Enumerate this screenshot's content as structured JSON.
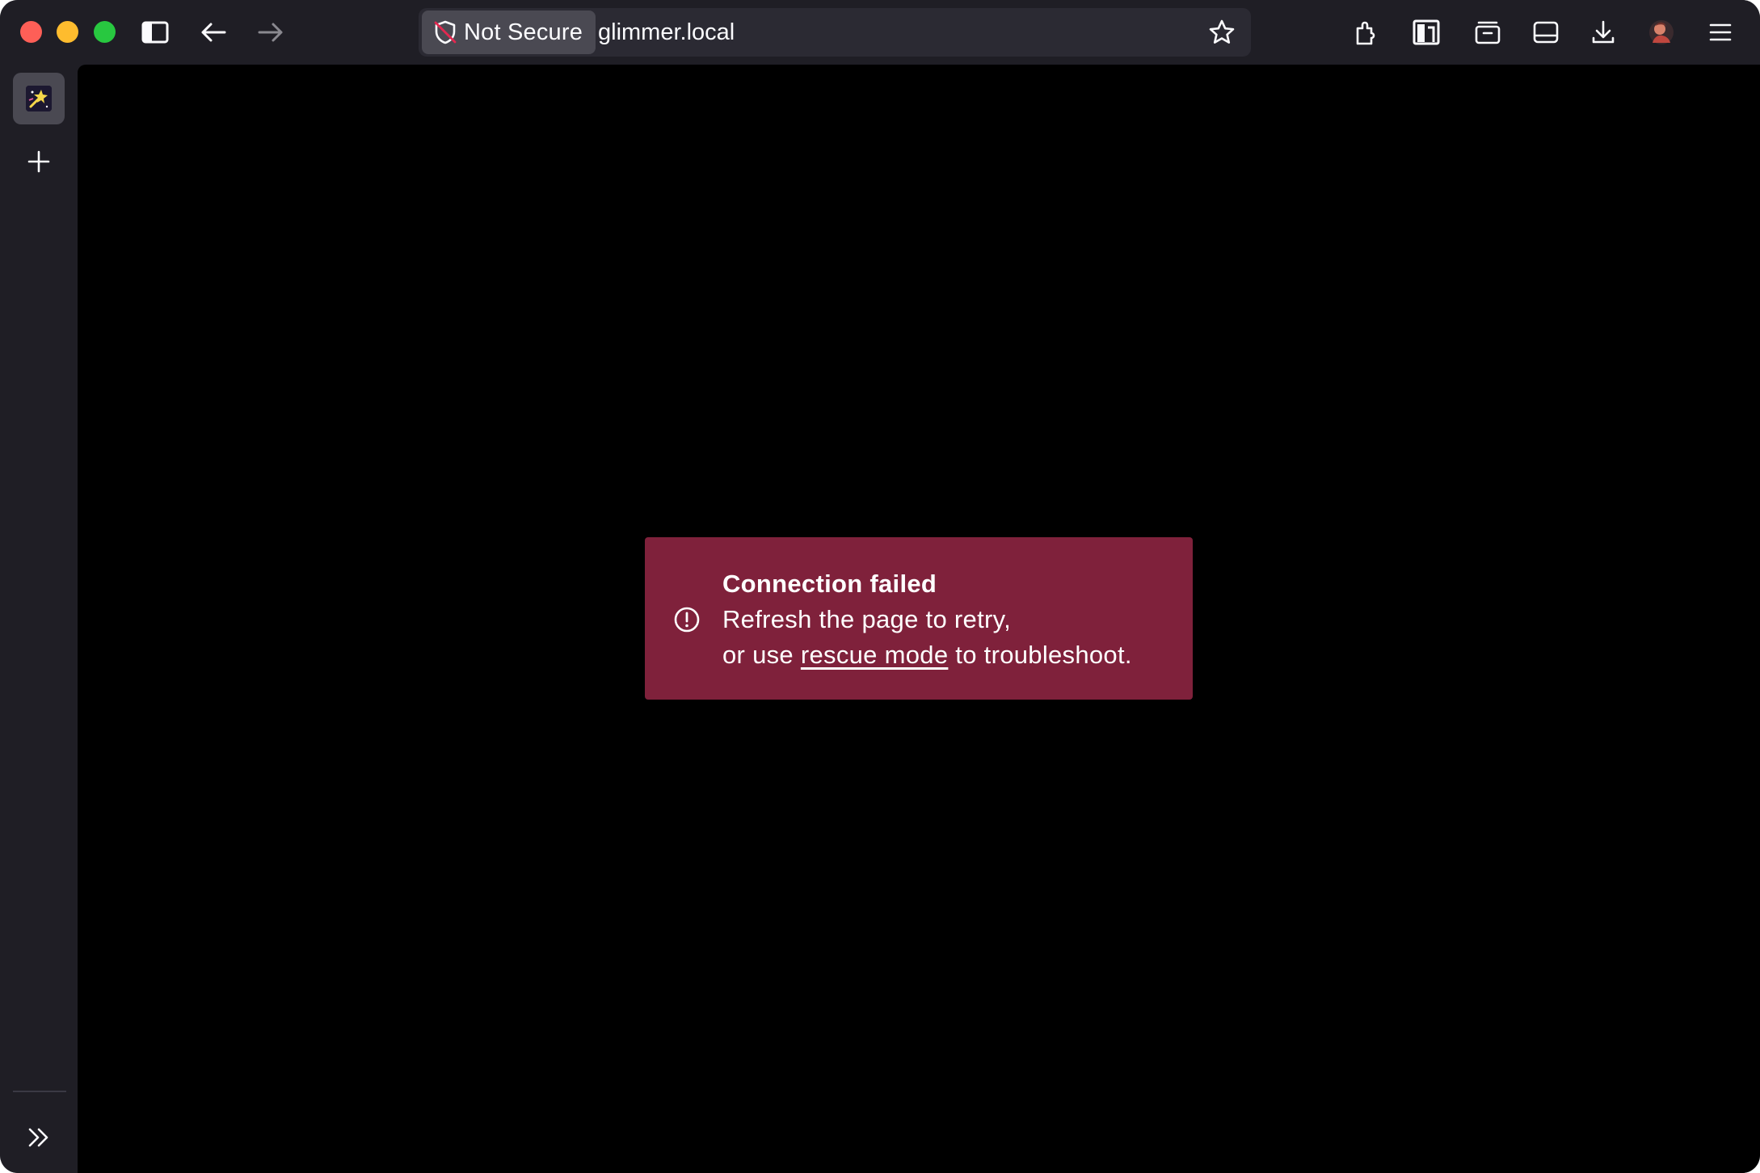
{
  "browser": {
    "url_bar": {
      "security_label": "Not Secure",
      "url": "glimmer.local"
    },
    "icons": {
      "sidebar_toggle": "sidebar-icon",
      "back": "arrow-left-icon",
      "forward": "arrow-right-icon",
      "bookmark": "star-icon",
      "extensions": "puzzle-icon",
      "reader": "library-icon",
      "tab_manager": "tabs-icon",
      "sidebar_panel": "panel-icon",
      "downloads": "download-icon",
      "account": "avatar",
      "menu": "hamburger-menu-icon"
    }
  },
  "sidebar": {
    "tab_favicon": "glimmer-favicon",
    "new_tab_icon": "plus-icon",
    "expand_icon": "chevron-double-right-icon"
  },
  "error": {
    "title": "Connection failed",
    "line1": "Refresh the page to retry,",
    "line2_prefix": "or use ",
    "link_text": "rescue mode",
    "line2_suffix": " to troubleshoot."
  },
  "colors": {
    "chrome_bg": "#1f1e25",
    "urlbar_bg": "#2b2a33",
    "content_bg": "#000000",
    "error_bg": "#7f213b",
    "traffic_red": "#fe5f57",
    "traffic_yellow": "#febc2e",
    "traffic_green": "#28c840"
  }
}
